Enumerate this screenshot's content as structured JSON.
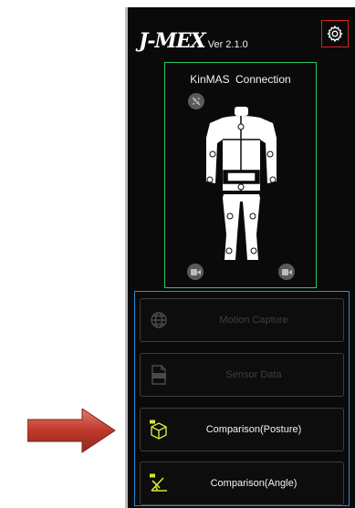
{
  "app": {
    "logo_text": "J-MEX",
    "version": "Ver 2.1.0"
  },
  "connection": {
    "title": "KinMAS  Connection"
  },
  "actions": {
    "motion_capture": "Motion Capture",
    "sensor_data": "Sensor Data",
    "comparison_posture": "Comparison(Posture)",
    "comparison_angle": "Comparison(Angle)"
  },
  "colors": {
    "panel_bg": "#0a0a0a",
    "connection_border": "#2ec66a",
    "action_group_border": "#2a8ed8",
    "settings_highlight": "#e02020",
    "icon_accent": "#d8e83a",
    "pointer_arrow": "#c0392b"
  },
  "icons": {
    "settings": "gear-icon",
    "disconnect": "no-link-icon",
    "record_left": "video-camera-icon",
    "record_right": "video-camera-icon",
    "motion_capture": "globe-icon",
    "sensor_data": "raw-data-icon",
    "comparison_posture": "cube-icon",
    "comparison_angle": "angle-icon"
  }
}
